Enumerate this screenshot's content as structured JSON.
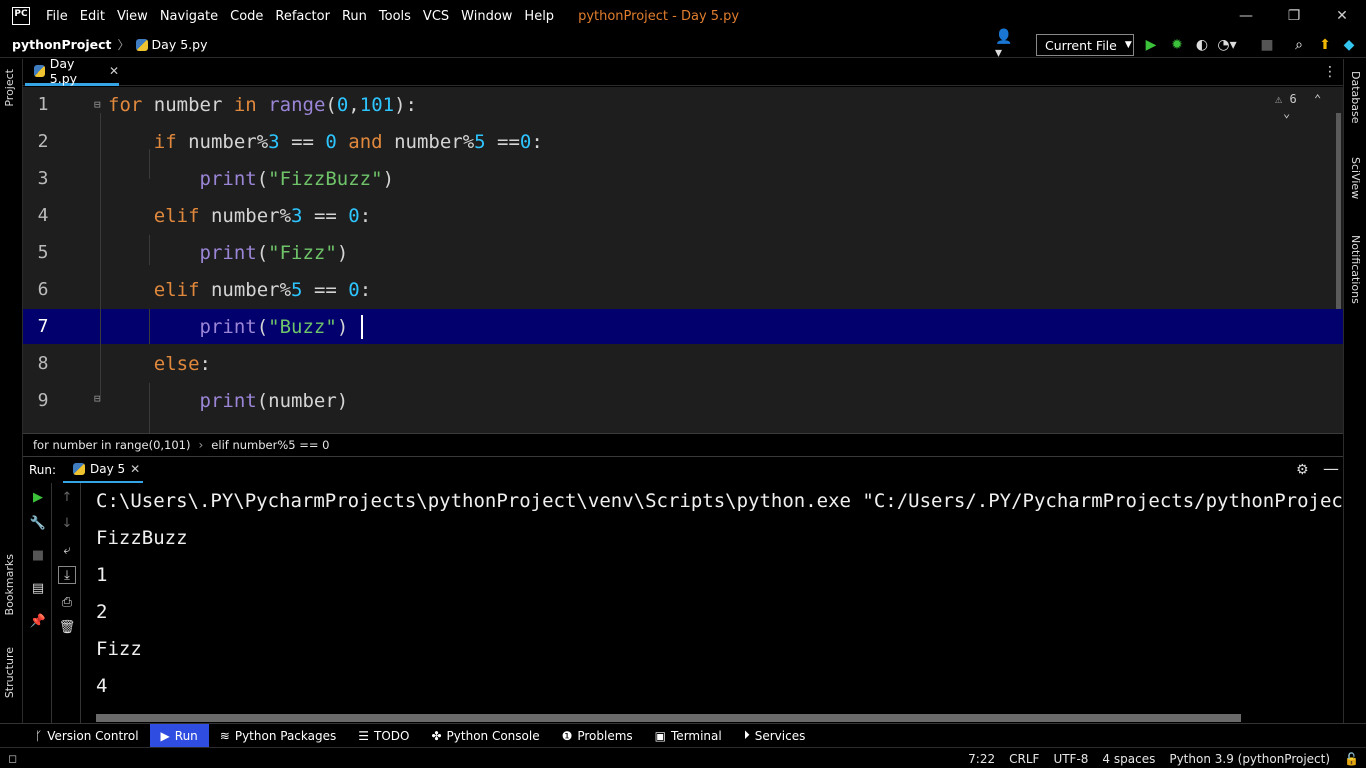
{
  "menu": [
    "File",
    "Edit",
    "View",
    "Navigate",
    "Code",
    "Refactor",
    "Run",
    "Tools",
    "VCS",
    "Window",
    "Help"
  ],
  "window_title": "pythonProject - Day 5.py",
  "app_logo": "PC",
  "navbar": {
    "project": "pythonProject",
    "file": "Day 5.py",
    "run_config": "Current File"
  },
  "left_tabs": {
    "project": "Project",
    "bookmarks": "Bookmarks",
    "structure": "Structure"
  },
  "right_tabs": {
    "database": "Database",
    "sciview": "SciView",
    "notifications": "Notifications"
  },
  "editor_tab": {
    "label": "Day 5.py"
  },
  "inspections": {
    "warnings": "6"
  },
  "line_numbers": [
    "1",
    "2",
    "3",
    "4",
    "5",
    "6",
    "7",
    "8",
    "9"
  ],
  "breadcrumbs": [
    "for number in range(0,101)",
    "elif number%5 == 0"
  ],
  "run_panel": {
    "label": "Run:",
    "tab": "Day 5"
  },
  "console": {
    "lines": [
      "C:\\Users\\.PY\\PycharmProjects\\pythonProject\\venv\\Scripts\\python.exe \"C:/Users/.PY/PycharmProjects/pythonProject/Da",
      "FizzBuzz",
      "1",
      "2",
      "Fizz",
      "4"
    ]
  },
  "bottom_tabs": [
    "Version Control",
    "Run",
    "Python Packages",
    "TODO",
    "Python Console",
    "Problems",
    "Terminal",
    "Services"
  ],
  "status": {
    "position": "7:22",
    "line_sep": "CRLF",
    "encoding": "UTF-8",
    "indent": "4 spaces",
    "interpreter": "Python 3.9 (pythonProject)"
  }
}
